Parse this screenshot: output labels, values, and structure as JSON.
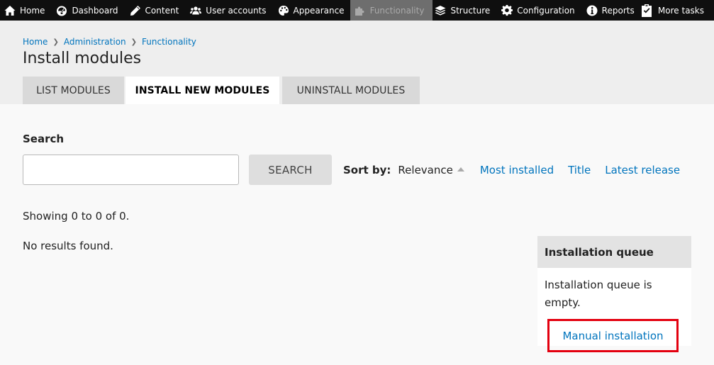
{
  "toolbar": {
    "items": [
      {
        "label": "Home",
        "icon": "home-icon"
      },
      {
        "label": "Dashboard",
        "icon": "dashboard-icon"
      },
      {
        "label": "Content",
        "icon": "pencil-icon"
      },
      {
        "label": "User accounts",
        "icon": "users-icon"
      },
      {
        "label": "Appearance",
        "icon": "palette-icon"
      },
      {
        "label": "Functionality",
        "icon": "puzzle-icon",
        "active": true
      },
      {
        "label": "Structure",
        "icon": "layers-icon"
      },
      {
        "label": "Configuration",
        "icon": "gear-icon"
      },
      {
        "label": "Reports",
        "icon": "info-icon"
      }
    ],
    "more": {
      "label": "More tasks",
      "icon": "clipboard-check-icon"
    }
  },
  "breadcrumb": [
    "Home",
    "Administration",
    "Functionality"
  ],
  "page_title": "Install modules",
  "tabs": [
    {
      "label": "LIST MODULES"
    },
    {
      "label": "INSTALL NEW MODULES",
      "active": true
    },
    {
      "label": "UNINSTALL MODULES"
    }
  ],
  "search": {
    "label": "Search",
    "value": "",
    "button": "SEARCH"
  },
  "sort": {
    "label": "Sort by:",
    "current": "Relevance",
    "options": [
      "Most installed",
      "Title",
      "Latest release"
    ]
  },
  "results": {
    "showing": "Showing 0 to 0 of 0.",
    "empty": "No results found."
  },
  "queue": {
    "title": "Installation queue",
    "body": "Installation queue is empty."
  },
  "manual_installation": "Manual installation",
  "colors": {
    "link": "#0074bd",
    "toolbar_bg": "#0f0f0f",
    "highlight": "#e3000f"
  }
}
